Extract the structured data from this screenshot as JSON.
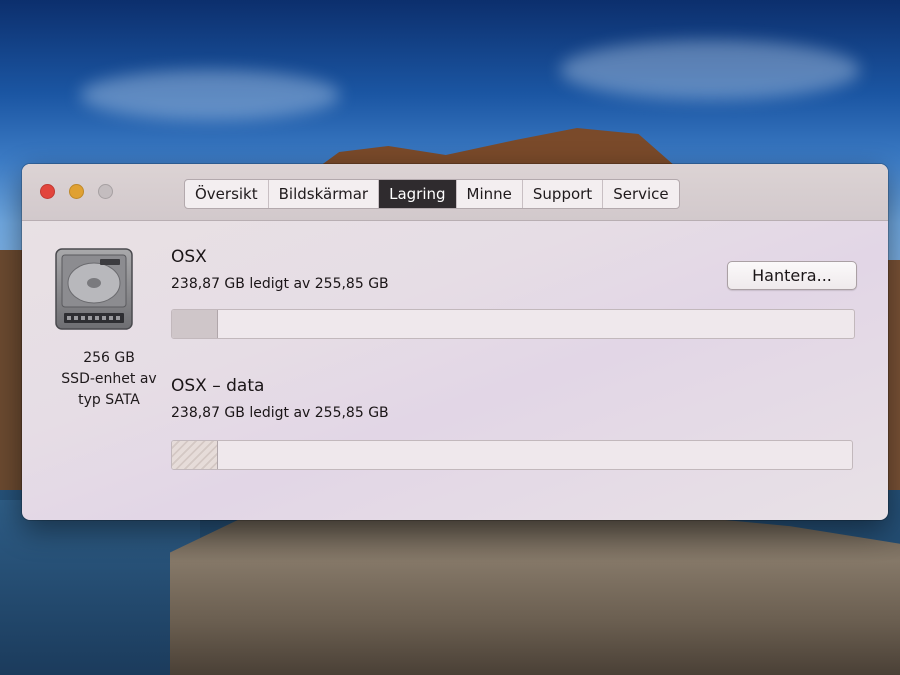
{
  "window": {
    "tabs": [
      {
        "label": "Översikt",
        "active": false
      },
      {
        "label": "Bildskärmar",
        "active": false
      },
      {
        "label": "Lagring",
        "active": true
      },
      {
        "label": "Minne",
        "active": false
      },
      {
        "label": "Support",
        "active": false
      },
      {
        "label": "Service",
        "active": false
      }
    ]
  },
  "disk": {
    "icon": "hard-drive-icon",
    "capacity": "256 GB",
    "type_line1": "SSD-enhet av",
    "type_line2": "typ SATA"
  },
  "volumes": [
    {
      "name": "OSX",
      "usage": "238,87 GB ledigt av 255,85 GB",
      "used_fraction": 0.066
    },
    {
      "name": "OSX – data",
      "usage": "238,87 GB ledigt av 255,85 GB",
      "used_fraction": 0.066
    }
  ],
  "actions": {
    "manage_label": "Hantera..."
  },
  "colors": {
    "close": "#e2453c",
    "minimize": "#e0a132",
    "zoom_disabled": "#c4bdbf",
    "active_tab": "#2f2b2e"
  }
}
